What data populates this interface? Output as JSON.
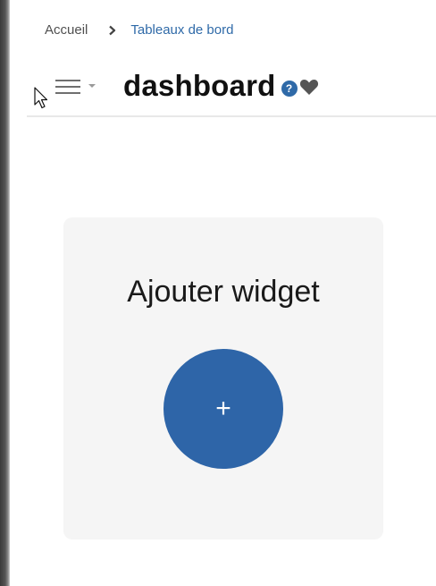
{
  "breadcrumb": {
    "home": "Accueil",
    "separator_icon": "chevron-right-icon",
    "current": "Tableaux de bord"
  },
  "header": {
    "menu_icon": "hamburger-menu-icon",
    "dropdown_icon": "caret-down-icon",
    "title": "dashboard",
    "help_icon": "?",
    "favorite_icon": "heart-icon"
  },
  "widget_card": {
    "title": "Ajouter widget",
    "add_button_label": "+"
  },
  "colors": {
    "accent": "#2e65a8",
    "link": "#2f6aa8",
    "card_background": "#f5f5f5",
    "icon_gray": "#555555"
  }
}
